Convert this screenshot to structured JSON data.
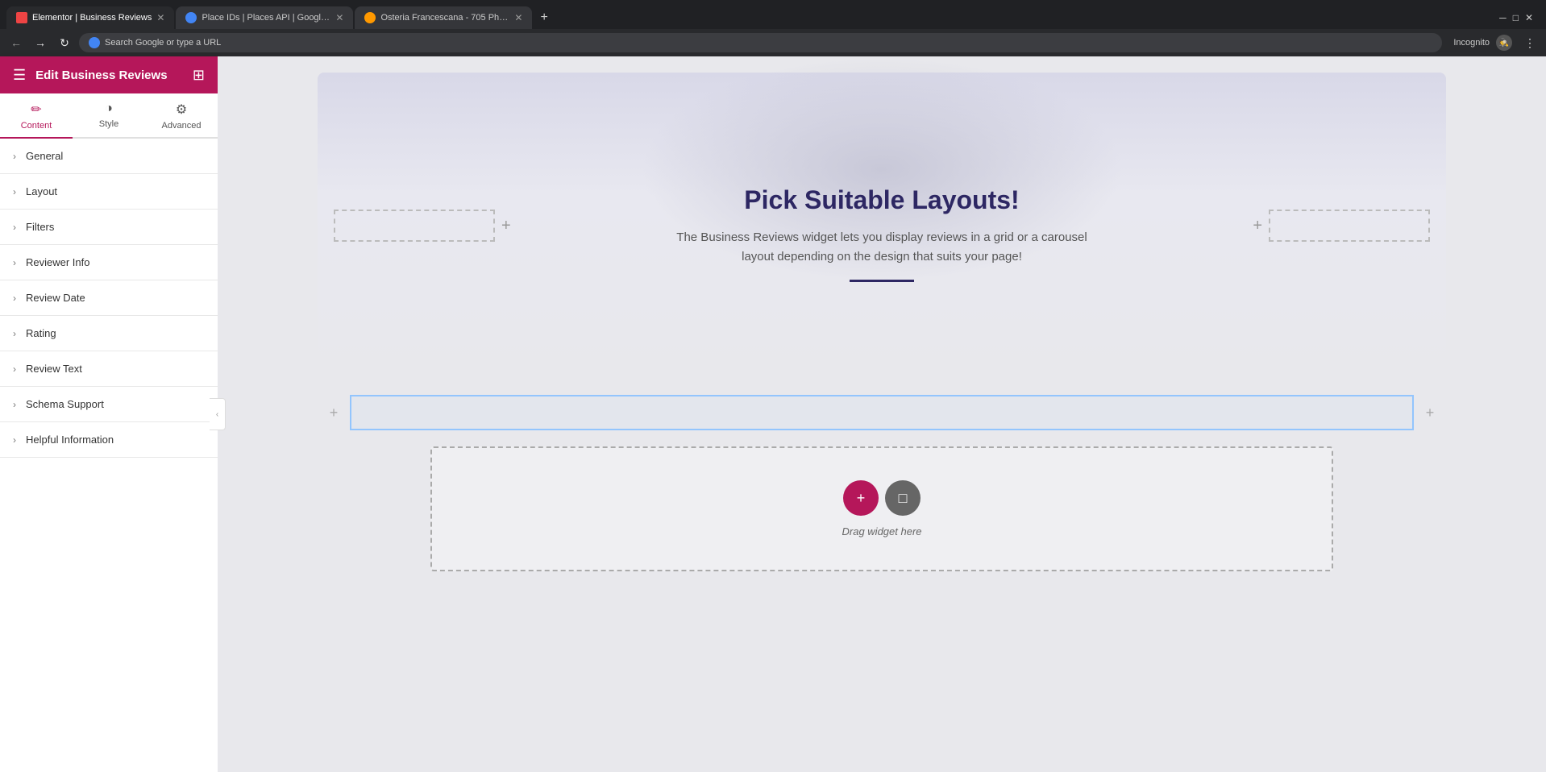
{
  "browser": {
    "tabs": [
      {
        "id": "tab1",
        "title": "Elementor | Business Reviews",
        "active": true,
        "faviconType": "red"
      },
      {
        "id": "tab2",
        "title": "Place IDs | Places API | Google...",
        "active": false,
        "faviconType": "google"
      },
      {
        "id": "tab3",
        "title": "Osteria Francescana - 705 Photo...",
        "active": false,
        "faviconType": "orange"
      }
    ],
    "addressBar": {
      "placeholder": "Search Google or type a URL",
      "text": "Search Google or type a URL"
    },
    "incognito": {
      "label": "Incognito"
    }
  },
  "sidebar": {
    "title": "Edit Business Reviews",
    "tabs": [
      {
        "id": "content",
        "label": "Content",
        "icon": "✏️",
        "active": true
      },
      {
        "id": "style",
        "label": "Style",
        "icon": "◑",
        "active": false
      },
      {
        "id": "advanced",
        "label": "Advanced",
        "icon": "⚙️",
        "active": false
      }
    ],
    "sections": [
      {
        "id": "general",
        "label": "General"
      },
      {
        "id": "layout",
        "label": "Layout"
      },
      {
        "id": "filters",
        "label": "Filters"
      },
      {
        "id": "reviewer-info",
        "label": "Reviewer Info"
      },
      {
        "id": "review-date",
        "label": "Review Date"
      },
      {
        "id": "rating",
        "label": "Rating"
      },
      {
        "id": "review-text",
        "label": "Review Text"
      },
      {
        "id": "schema-support",
        "label": "Schema Support"
      },
      {
        "id": "helpful-information",
        "label": "Helpful Information"
      }
    ]
  },
  "main": {
    "hero": {
      "title": "Pick Suitable Layouts!",
      "subtitle": "The Business Reviews widget lets you display reviews in a grid or a carousel layout depending on the design that suits your page!"
    },
    "dropZone": {
      "text": "Drag widget here"
    },
    "addButtons": {
      "plus": "+"
    }
  }
}
